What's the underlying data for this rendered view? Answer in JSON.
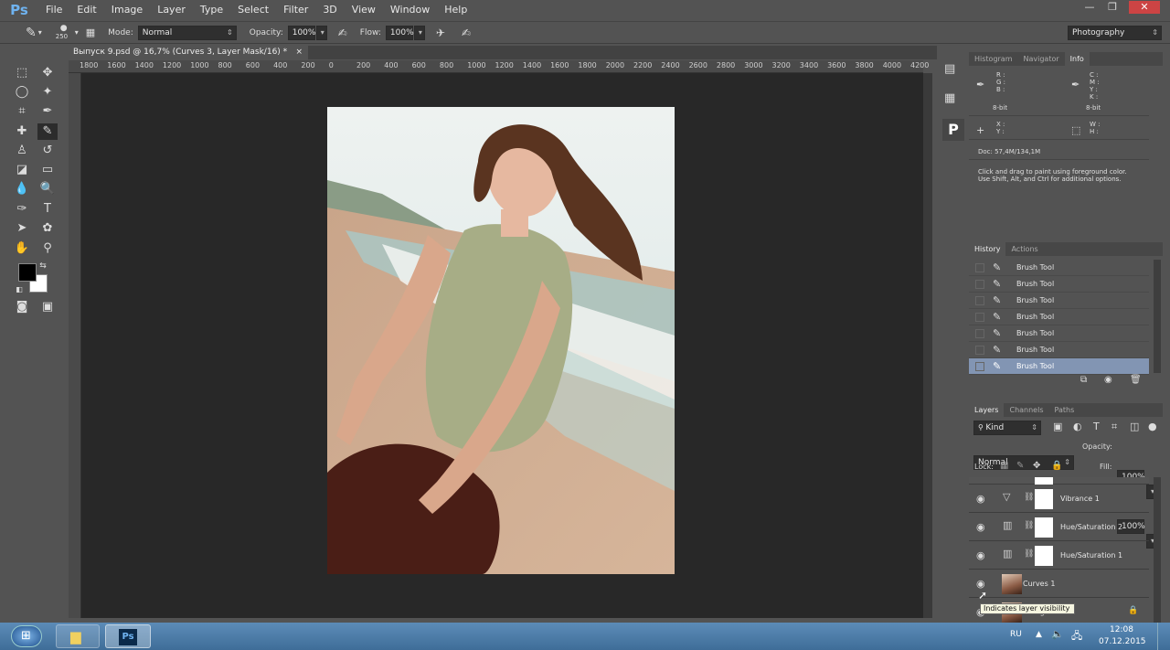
{
  "app": {
    "logo": "Ps"
  },
  "menu": [
    "File",
    "Edit",
    "Image",
    "Layer",
    "Type",
    "Select",
    "Filter",
    "3D",
    "View",
    "Window",
    "Help"
  ],
  "window_controls": [
    "—",
    "❐",
    "✕"
  ],
  "options": {
    "brush_size": "250",
    "mode_label": "Mode:",
    "mode_value": "Normal",
    "opacity_label": "Opacity:",
    "opacity_value": "100%",
    "flow_label": "Flow:",
    "flow_value": "100%",
    "workspace": "Photography"
  },
  "document": {
    "tab_title": "Выпуск 9.psd @ 16,7% (Curves 3, Layer Mask/16) *",
    "close": "×"
  },
  "ruler_labels": [
    "1800",
    "1600",
    "1400",
    "1200",
    "1000",
    "800",
    "600",
    "400",
    "200",
    "0",
    "200",
    "400",
    "600",
    "800",
    "1000",
    "1200",
    "1400",
    "1600",
    "1800",
    "2000",
    "2200",
    "2400",
    "2600",
    "2800",
    "3000",
    "3200",
    "3400",
    "3600",
    "3800",
    "4000",
    "4200"
  ],
  "info_panel": {
    "tabs": [
      "Histogram",
      "Navigator",
      "Info"
    ],
    "active_tab": "Info",
    "rgb": "R :\nG :\nB :",
    "cmyk": "C :\nM :\nY :\nK :",
    "bit1": "8-bit",
    "bit2": "8-bit",
    "xy": "X :\nY :",
    "wh": "W :\nH :",
    "doc": "Doc: 57,4M/134,1M",
    "hint": "Click and drag to paint using foreground color.\nUse Shift, Alt, and Ctrl for additional options."
  },
  "history_panel": {
    "tabs": [
      "History",
      "Actions"
    ],
    "active_tab": "History",
    "items": [
      "Brush Tool",
      "Brush Tool",
      "Brush Tool",
      "Brush Tool",
      "Brush Tool",
      "Brush Tool",
      "Brush Tool"
    ],
    "selected_index": 6
  },
  "layers_panel": {
    "tabs": [
      "Layers",
      "Channels",
      "Paths"
    ],
    "active_tab": "Layers",
    "kind": "Kind",
    "blend_mode": "Normal",
    "opacity_label": "Opacity:",
    "opacity_value": "100%",
    "lock_label": "Lock:",
    "fill_label": "Fill:",
    "fill_value": "100%",
    "layers": [
      {
        "name": "Vibrance 1",
        "type": "adjustment",
        "icon": "vibrance-icon"
      },
      {
        "name": "Hue/Saturation 2",
        "type": "adjustment",
        "icon": "hue-saturation-icon"
      },
      {
        "name": "Hue/Saturation 1",
        "type": "adjustment",
        "icon": "hue-saturation-icon"
      },
      {
        "name": "Curves 1",
        "type": "pixel",
        "icon": "thumbnail"
      },
      {
        "name": "Background",
        "type": "pixel",
        "icon": "thumbnail",
        "locked": true
      }
    ],
    "tooltip": "Indicates layer visibility"
  },
  "taskbar": {
    "language": "RU",
    "time": "12:08",
    "date": "07.12.2015",
    "ps_label": "Ps"
  },
  "colors": {
    "ui_bg": "#535353",
    "canvas_bg": "#282828",
    "selection": "#8295b3",
    "ps_blue": "#6fb3f0"
  }
}
